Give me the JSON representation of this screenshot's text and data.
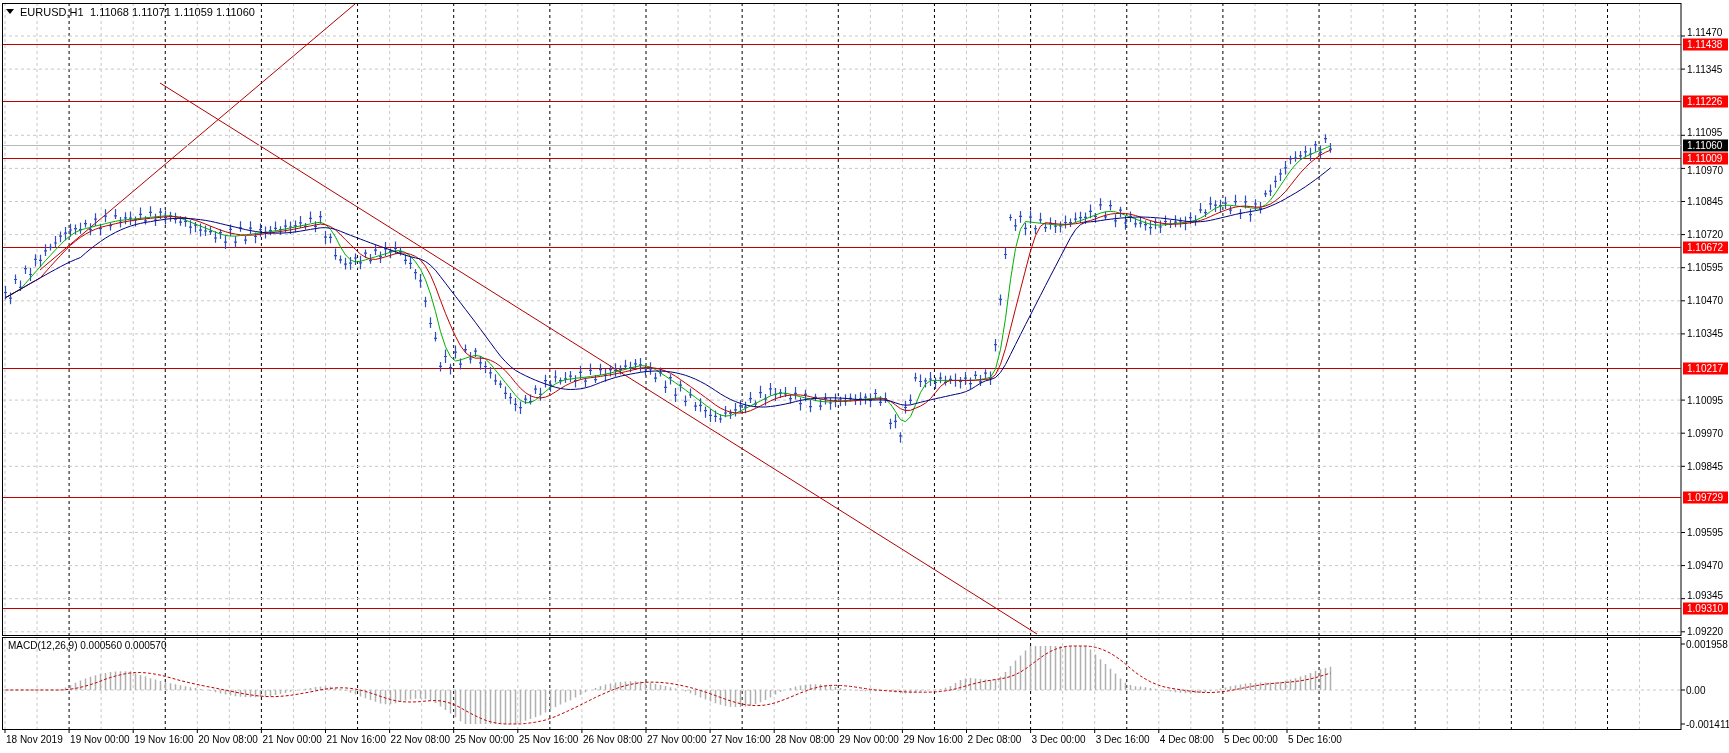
{
  "header": {
    "symbol": "EURUSD,H1",
    "quote": "1.11068 1.11071 1.11059 1.11060"
  },
  "price_axis": [
    "1.11470",
    "1.11345",
    "1.11095",
    "1.10970",
    "1.10845",
    "1.10720",
    "1.10595",
    "1.10470",
    "1.10345",
    "1.10095",
    "1.09970",
    "1.09845",
    "1.09595",
    "1.09470",
    "1.09345",
    "1.09220"
  ],
  "levels": [
    {
      "label": "1.11438",
      "kind": "level"
    },
    {
      "label": "1.11226",
      "kind": "level"
    },
    {
      "label": "1.11060",
      "kind": "current"
    },
    {
      "label": "1.11009",
      "kind": "level"
    },
    {
      "label": "1.10672",
      "kind": "level"
    },
    {
      "label": "1.10217",
      "kind": "level"
    },
    {
      "label": "1.09729",
      "kind": "level"
    },
    {
      "label": "1.09310",
      "kind": "level"
    }
  ],
  "macd": {
    "title": "MACD(12,26,9) 0.000560 0.000570",
    "axis": [
      "0.001958",
      "0.00",
      "-0.001411"
    ]
  },
  "time_axis": [
    "18 Nov 2019",
    "19 Nov 00:00",
    "19 Nov 16:00",
    "20 Nov 08:00",
    "21 Nov 00:00",
    "21 Nov 16:00",
    "22 Nov 08:00",
    "25 Nov 00:00",
    "25 Nov 16:00",
    "26 Nov 08:00",
    "27 Nov 00:00",
    "27 Nov 16:00",
    "28 Nov 08:00",
    "29 Nov 00:00",
    "29 Nov 16:00",
    "2 Dec 08:00",
    "3 Dec 00:00",
    "3 Dec 16:00",
    "4 Dec 08:00",
    "5 Dec 00:00",
    "5 Dec 16:00"
  ]
}
